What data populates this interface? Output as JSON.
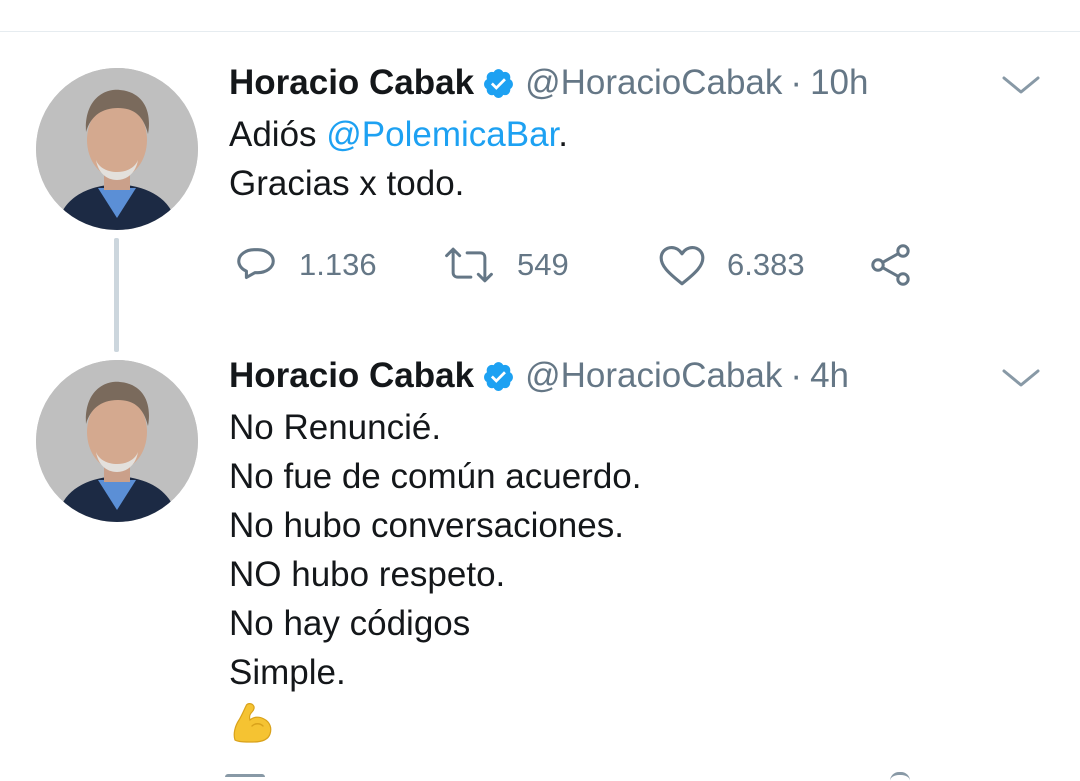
{
  "colors": {
    "accent": "#1da1f2",
    "muted_text": "#657786",
    "primary_text": "#14171a",
    "thread_line": "#ccd6dd",
    "flex_emoji": "#f5c332"
  },
  "tweets": [
    {
      "author_name": "Horacio Cabak",
      "handle": "@HoracioCabak",
      "separator": "·",
      "time": "10h",
      "verified_icon": "verified-badge-icon",
      "text_prefix": "Adiós ",
      "mention": "@PolemicaBar",
      "text_suffix": ".",
      "text_line2": "Gracias x todo.",
      "actions": {
        "reply_count": "1.136",
        "retweet_count": "549",
        "like_count": "6.383",
        "icons": [
          "reply-icon",
          "retweet-icon",
          "like-icon",
          "share-icon"
        ]
      }
    },
    {
      "author_name": "Horacio Cabak",
      "handle": "@HoracioCabak",
      "separator": "·",
      "time": "4h",
      "verified_icon": "verified-badge-icon",
      "lines": [
        "No Renuncié.",
        "No fue de común acuerdo.",
        "No hubo conversaciones.",
        "NO hubo respeto.",
        "No hay códigos",
        "Simple."
      ],
      "emoji": "flexed-biceps-emoji"
    }
  ]
}
